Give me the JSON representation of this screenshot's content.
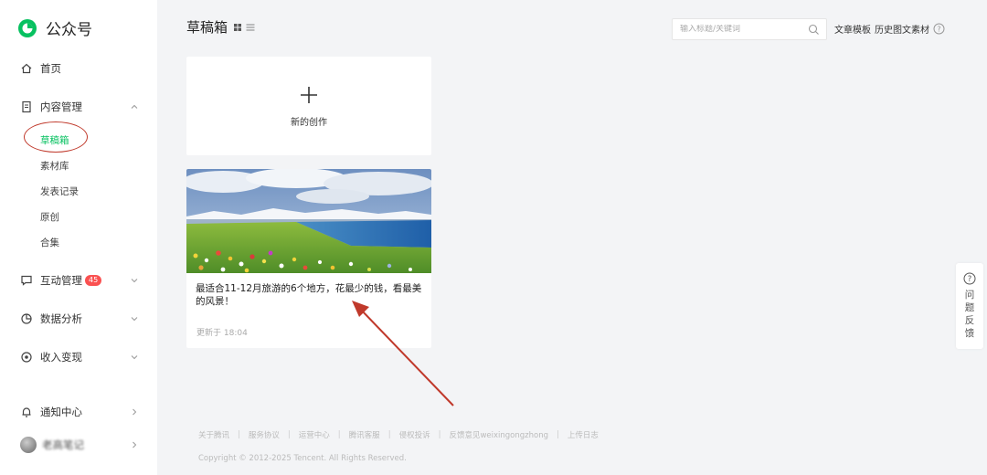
{
  "app": {
    "title": "公众号"
  },
  "sidebar": {
    "home": "首页",
    "content": "内容管理",
    "sub_items": [
      "草稿箱",
      "素材库",
      "发表记录",
      "原创",
      "合集"
    ],
    "interaction": "互动管理",
    "interaction_badge": "45",
    "analytics": "数据分析",
    "revenue": "收入变现",
    "notifications": "通知中心",
    "account_name": "老高笔记"
  },
  "header": {
    "title": "草稿箱",
    "search_placeholder": "输入标题/关键词",
    "links": [
      "文章模板",
      "历史图文素材"
    ]
  },
  "new_card": {
    "label": "新的创作"
  },
  "article": {
    "title": "最适合11-12月旅游的6个地方，花最少的钱，看最美的风景！",
    "updated": "更新于 18:04"
  },
  "feedback": {
    "label": "问题反馈"
  },
  "footer": {
    "links": [
      "关于腾讯",
      "服务协议",
      "运营中心",
      "腾讯客服",
      "侵权投诉",
      "反馈意见weixingongzhong",
      "上传日志"
    ],
    "copyright": "Copyright © 2012-2025 Tencent. All Rights Reserved."
  },
  "colors": {
    "accent": "#07c160",
    "badge": "#fa5151",
    "annotation": "#c0392b"
  }
}
